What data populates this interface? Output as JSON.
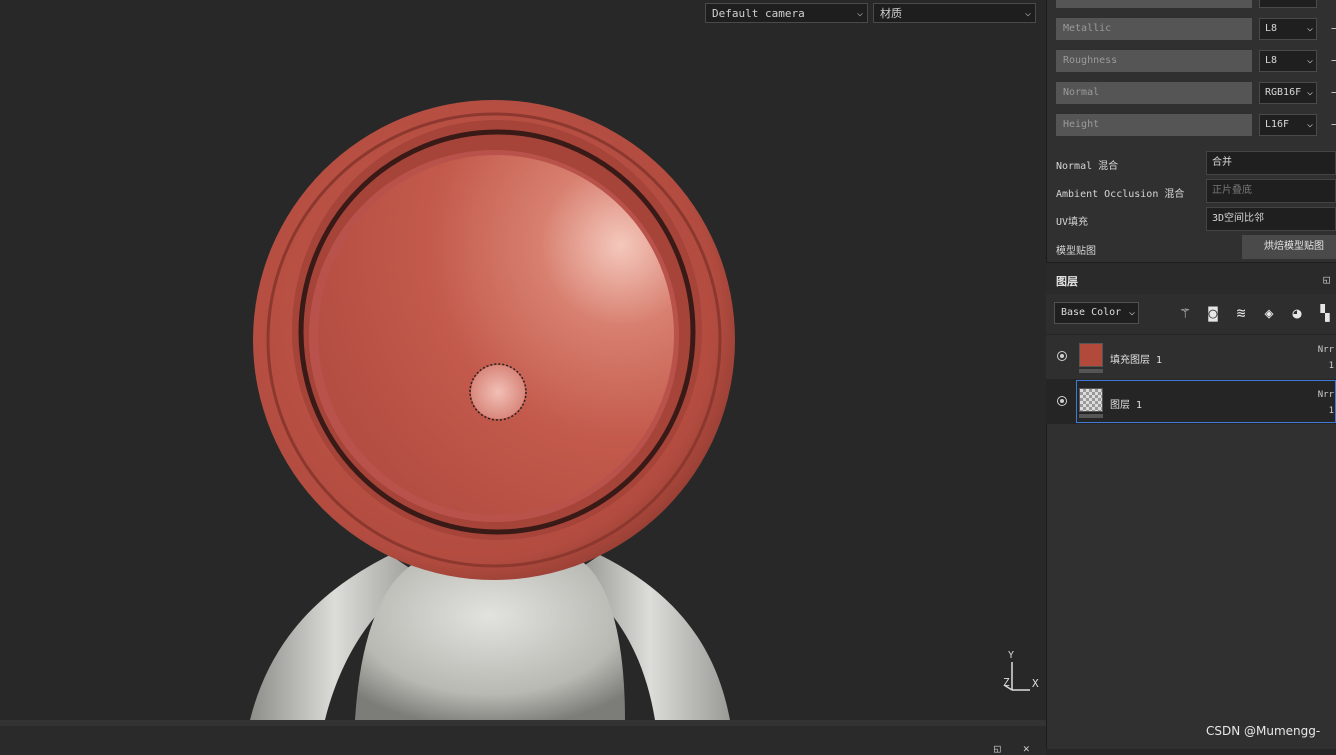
{
  "viewport": {
    "camera_select": "Default camera",
    "material_select": "材质",
    "axis_labels": {
      "y": "Y",
      "x": "X",
      "z": "Z"
    }
  },
  "channels": [
    {
      "label": "Metallic",
      "format": "L8"
    },
    {
      "label": "Roughness",
      "format": "L8"
    },
    {
      "label": "Normal",
      "format": "RGB16F"
    },
    {
      "label": "Height",
      "format": "L16F"
    }
  ],
  "channel_minus": "−",
  "properties": {
    "normal_mix_label": "Normal 混合",
    "normal_mix_value": "合并",
    "ao_mix_label": "Ambient Occlusion 混合",
    "ao_mix_placeholder": "正片叠底",
    "uv_fill_label": "UV填充",
    "uv_fill_value": "3D空间比邻",
    "mesh_maps_label": "模型贴图",
    "bake_button": "烘焙模型贴图"
  },
  "layers_panel": {
    "title": "图层",
    "channel_select": "Base Color",
    "layers": [
      {
        "name": "填充图层 1",
        "blend": "Nrr",
        "opacity": "1",
        "thumb_color": "#b24a3c",
        "selected": false
      },
      {
        "name": "图层 1",
        "blend": "Nrr",
        "opacity": "1",
        "thumb_color": "checker",
        "selected": true
      }
    ]
  },
  "colors": {
    "sphere_red": "#c0564a",
    "selection_blue": "#3f7bd4"
  },
  "watermark": "CSDN @Mumengg-"
}
